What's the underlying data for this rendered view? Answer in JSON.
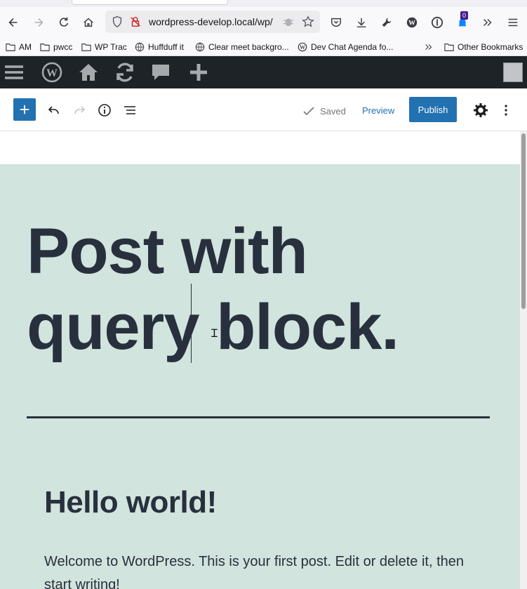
{
  "browser": {
    "url": "wordpress-develop.local/wp/",
    "extension_badge": "0",
    "bookmarks": [
      {
        "label": "AM",
        "icon": "folder-icon"
      },
      {
        "label": "pwcc",
        "icon": "folder-icon"
      },
      {
        "label": "WP Trac",
        "icon": "folder-icon"
      },
      {
        "label": "Huffduff it",
        "icon": "globe-icon"
      },
      {
        "label": "Clear meet backgro...",
        "icon": "globe-icon"
      },
      {
        "label": "Dev Chat Agenda fo...",
        "icon": "wordpress-icon"
      }
    ],
    "other_bookmarks": "Other Bookmarks"
  },
  "editor": {
    "saved_label": "Saved",
    "preview_label": "Preview",
    "publish_label": "Publish"
  },
  "post": {
    "title": "Post with query block.",
    "query": {
      "post_title": "Hello world!",
      "excerpt": "Welcome to WordPress. This is your first post. Edit or delete it, then start writing!"
    }
  },
  "colors": {
    "admin_bar": "#1d2327",
    "accent": "#2271b1",
    "canvas_bg": "#d1e4dd",
    "text": "#28303d"
  }
}
